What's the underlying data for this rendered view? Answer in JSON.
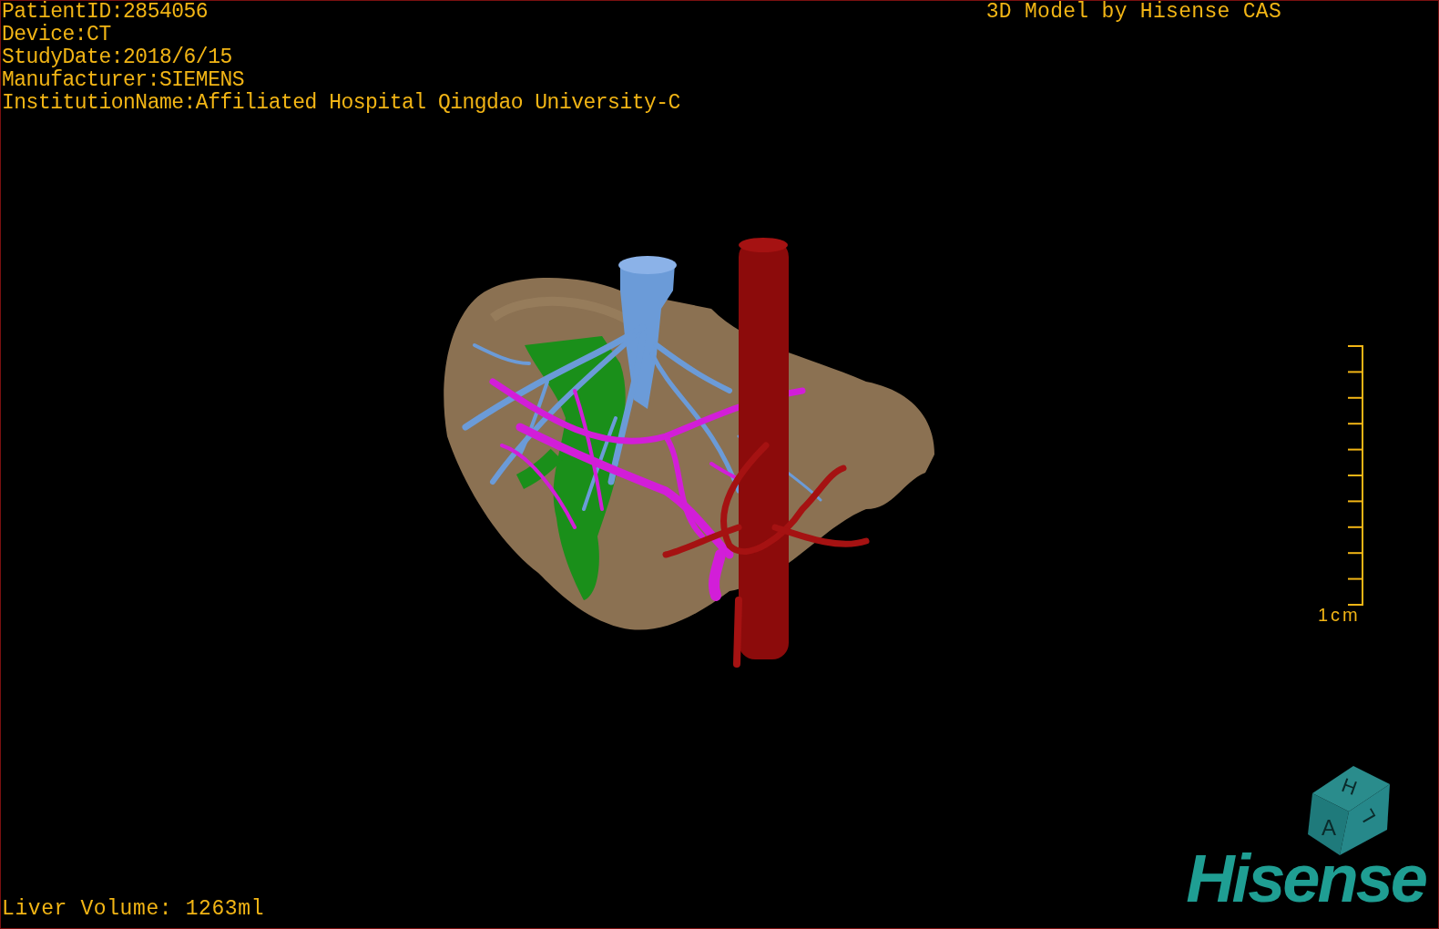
{
  "study_info": [
    "PatientID:2854056",
    "Device:CT",
    "StudyDate:2018/6/15",
    "Manufacturer:SIEMENS",
    "InstitutionName:Affiliated Hospital Qingdao University-C"
  ],
  "model_caption": "3D Model by Hisense CAS",
  "scale_bar": {
    "label": "1cm"
  },
  "orientation_cube": {
    "top": "H",
    "front": "A",
    "side": "L"
  },
  "liver_volume": "Liver Volume: 1263ml",
  "logo": "Hisense"
}
